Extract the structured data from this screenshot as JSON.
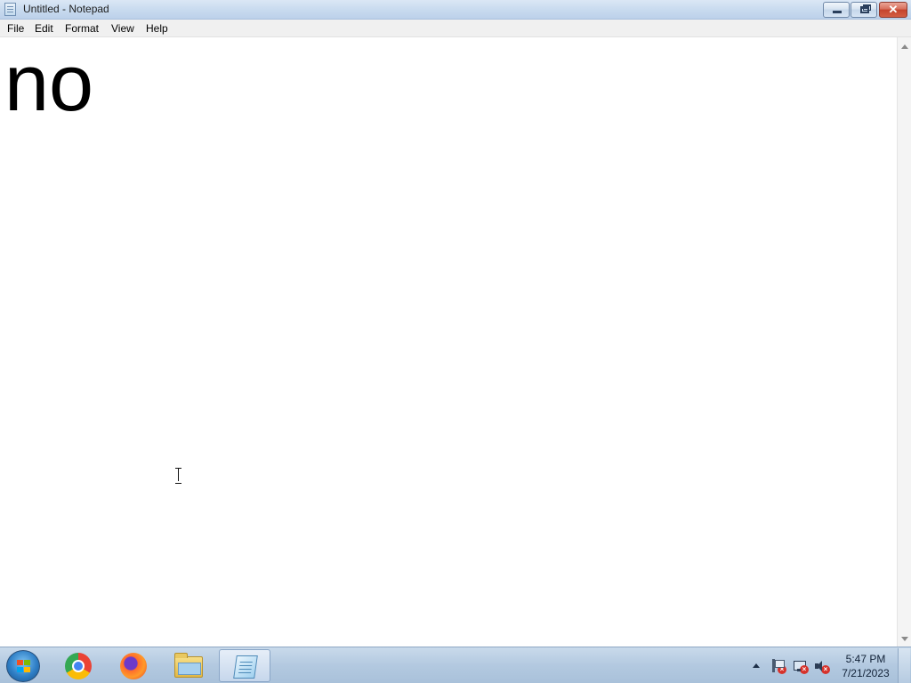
{
  "window": {
    "title": "Untitled - Notepad",
    "app_icon": "notepad-icon",
    "controls": {
      "minimize_icon": "minimize-icon",
      "maximize_icon": "restore-icon",
      "close_icon": "close-icon",
      "close_glyph": "✕"
    }
  },
  "menubar": {
    "items": [
      "File",
      "Edit",
      "Format",
      "View",
      "Help"
    ]
  },
  "editor": {
    "content": "no"
  },
  "taskbar": {
    "start_icon": "windows-start-icon",
    "apps": [
      {
        "name": "Google Chrome",
        "icon": "chrome-icon",
        "active": false
      },
      {
        "name": "Firefox",
        "icon": "firefox-icon",
        "active": false
      },
      {
        "name": "File Explorer",
        "icon": "folder-icon",
        "active": false
      },
      {
        "name": "Notepad",
        "icon": "notepad-icon",
        "active": true
      }
    ],
    "tray": {
      "icons": [
        "show-hidden-icons-arrow",
        "action-center-icon",
        "network-icon",
        "volume-muted-icon"
      ],
      "time": "5:47 PM",
      "date": "7/21/2023"
    }
  }
}
